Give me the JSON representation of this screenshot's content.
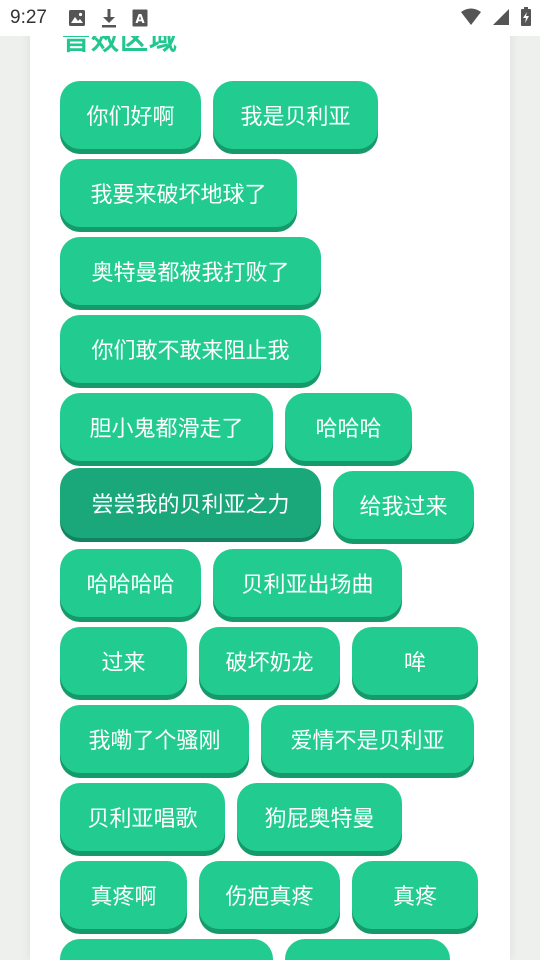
{
  "status_bar": {
    "time": "9:27",
    "left_icons": [
      "image-icon",
      "download-icon",
      "font-a-icon"
    ],
    "right_icons": [
      "wifi-icon",
      "signal-icon",
      "battery-icon"
    ]
  },
  "section": {
    "title": "音效区域"
  },
  "buttons": [
    {
      "label": "你们好啊"
    },
    {
      "label": "我是贝利亚"
    },
    {
      "label": "我要来破坏地球了"
    },
    {
      "label": "奥特曼都被我打败了"
    },
    {
      "label": "你们敢不敢来阻止我"
    },
    {
      "label": "胆小鬼都滑走了"
    },
    {
      "label": "哈哈哈"
    },
    {
      "label": "尝尝我的贝利亚之力",
      "state": "pressed"
    },
    {
      "label": "给我过来"
    },
    {
      "label": "哈哈哈哈"
    },
    {
      "label": "贝利亚出场曲"
    },
    {
      "label": "过来"
    },
    {
      "label": "破坏奶龙"
    },
    {
      "label": "哞"
    },
    {
      "label": "我嘞了个骚刚"
    },
    {
      "label": "爱情不是贝利亚"
    },
    {
      "label": "贝利亚唱歌"
    },
    {
      "label": "狗屁奥特曼"
    },
    {
      "label": "真疼啊"
    },
    {
      "label": "伤疤真疼"
    },
    {
      "label": "真疼"
    },
    {
      "label": ""
    },
    {
      "label": ""
    }
  ],
  "colors": {
    "accent": "#22cc91",
    "accent_shadow": "#16996b",
    "pressed": "#1aa87a",
    "title": "#21c78e",
    "panel": "#ffffff",
    "background": "#eef0ee"
  }
}
